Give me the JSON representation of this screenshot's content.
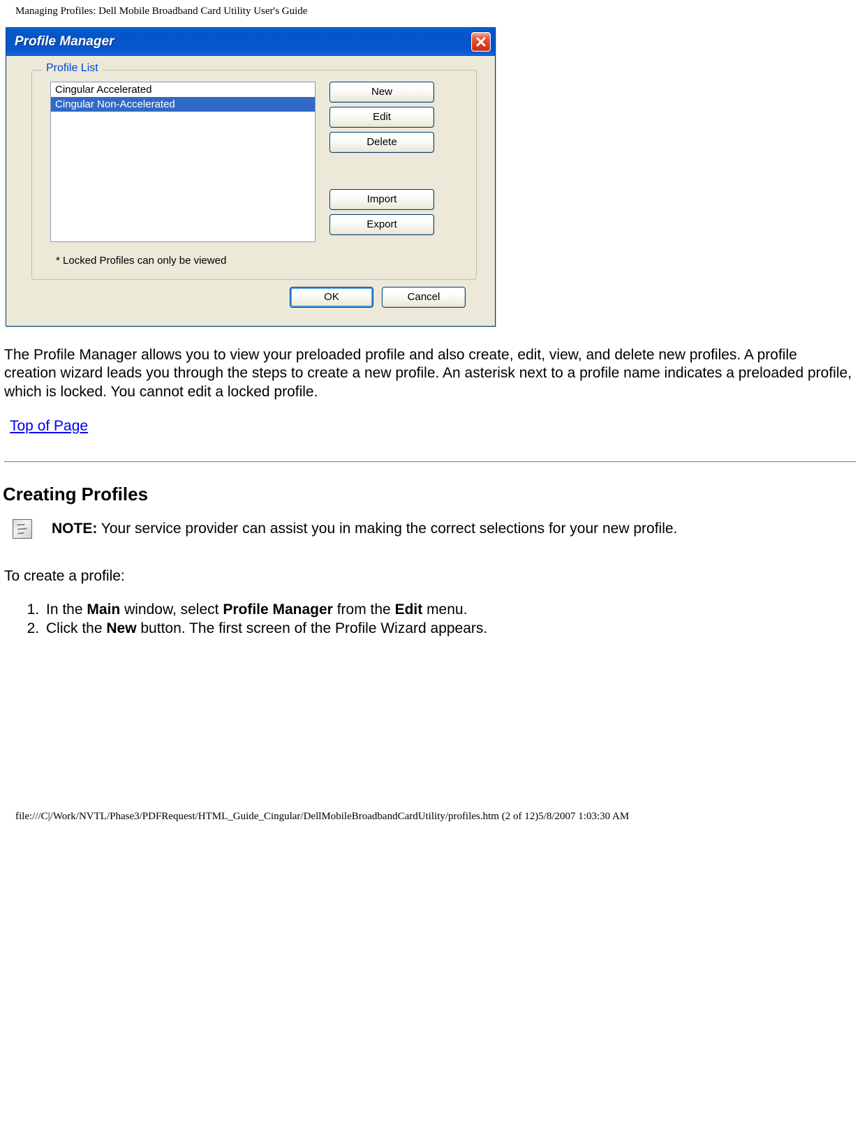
{
  "header": "Managing Profiles: Dell Mobile Broadband Card Utility User's Guide",
  "dialog": {
    "title": "Profile Manager",
    "fieldset_legend": "Profile List",
    "list_items": [
      "Cingular Accelerated",
      "Cingular Non-Accelerated"
    ],
    "selected_index": 1,
    "buttons": {
      "new": "New",
      "edit": "Edit",
      "delete": "Delete",
      "import": "Import",
      "export": "Export"
    },
    "locked_note": "* Locked Profiles can only be viewed",
    "ok": "OK",
    "cancel": "Cancel"
  },
  "paragraph": "The Profile Manager allows you to view your preloaded profile and also create, edit, view, and delete new profiles. A profile creation wizard leads you through the steps to create a new profile. An asterisk next to a profile name indicates a preloaded profile, which is locked. You cannot edit a locked profile.",
  "top_link": "Top of Page",
  "section_heading": "Creating Profiles",
  "note": {
    "label": "NOTE:",
    "text": " Your service provider can assist you in making the correct selections for your new profile."
  },
  "steps_intro": "To create a profile:",
  "steps": {
    "s1_a": "In the ",
    "s1_b": "Main",
    "s1_c": " window, select ",
    "s1_d": "Profile Manager",
    "s1_e": " from the ",
    "s1_f": "Edit",
    "s1_g": " menu.",
    "s2_a": "Click the ",
    "s2_b": "New",
    "s2_c": " button. The first screen of the Profile Wizard appears."
  },
  "footer": "file:///C|/Work/NVTL/Phase3/PDFRequest/HTML_Guide_Cingular/DellMobileBroadbandCardUtility/profiles.htm (2 of 12)5/8/2007 1:03:30 AM"
}
